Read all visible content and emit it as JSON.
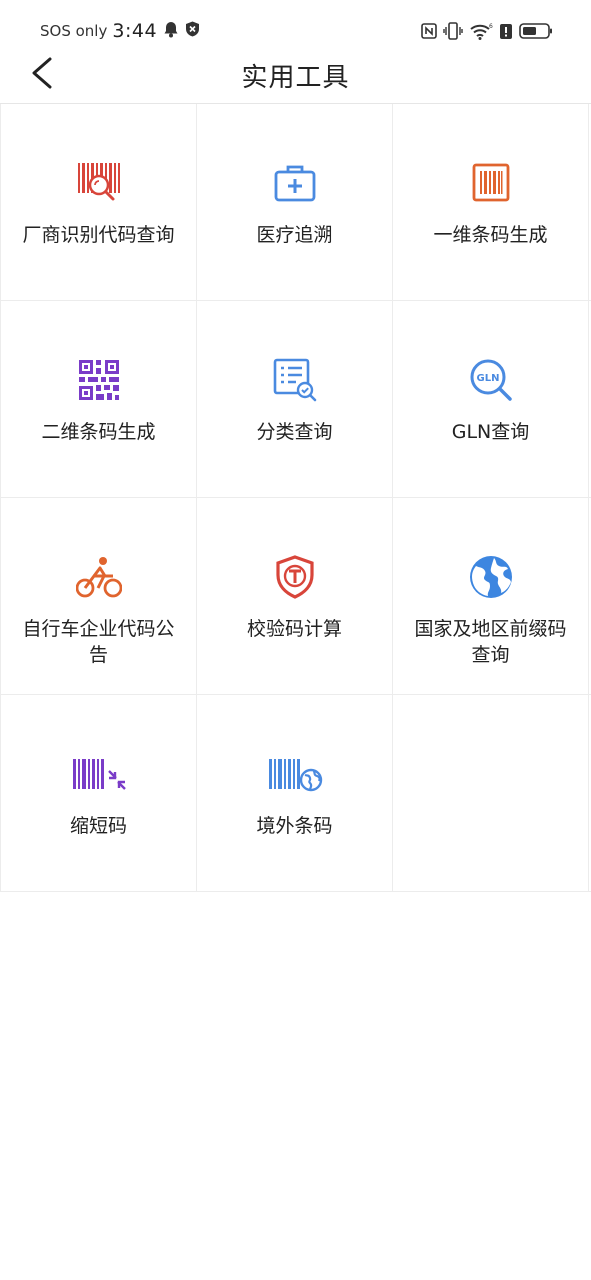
{
  "status_bar": {
    "carrier": "SOS only",
    "time": "3:44",
    "icons": [
      "bell-icon",
      "shield-icon",
      "nfc-icon",
      "vibrate-icon",
      "wifi-icon",
      "alert-icon",
      "battery-icon"
    ]
  },
  "header": {
    "title": "实用工具",
    "back_icon": "chevron-left-icon"
  },
  "tools": [
    {
      "label": "厂商识别代码查询",
      "icon": "barcode-search-icon",
      "color": "#d8453a"
    },
    {
      "label": "医疗追溯",
      "icon": "medical-kit-icon",
      "color": "#4a8ae0"
    },
    {
      "label": "一维条码生成",
      "icon": "barcode-box-icon",
      "color": "#e0642e"
    },
    {
      "label": "二维条码生成",
      "icon": "qr-code-icon",
      "color": "#7a3cc8"
    },
    {
      "label": "分类查询",
      "icon": "list-search-icon",
      "color": "#4a8ae0"
    },
    {
      "label": "GLN查询",
      "icon": "gln-search-icon",
      "color": "#4a8ae0"
    },
    {
      "label": "自行车企业代码公告",
      "icon": "bicycle-icon",
      "color": "#e0642e"
    },
    {
      "label": "校验码计算",
      "icon": "shield-t-icon",
      "color": "#d8453a"
    },
    {
      "label": "国家及地区前缀码查询",
      "icon": "globe-icon",
      "color": "#3d86e0"
    },
    {
      "label": "缩短码",
      "icon": "barcode-shrink-icon",
      "color": "#7a3cc8"
    },
    {
      "label": "境外条码",
      "icon": "barcode-globe-icon",
      "color": "#4a8ae0"
    }
  ]
}
